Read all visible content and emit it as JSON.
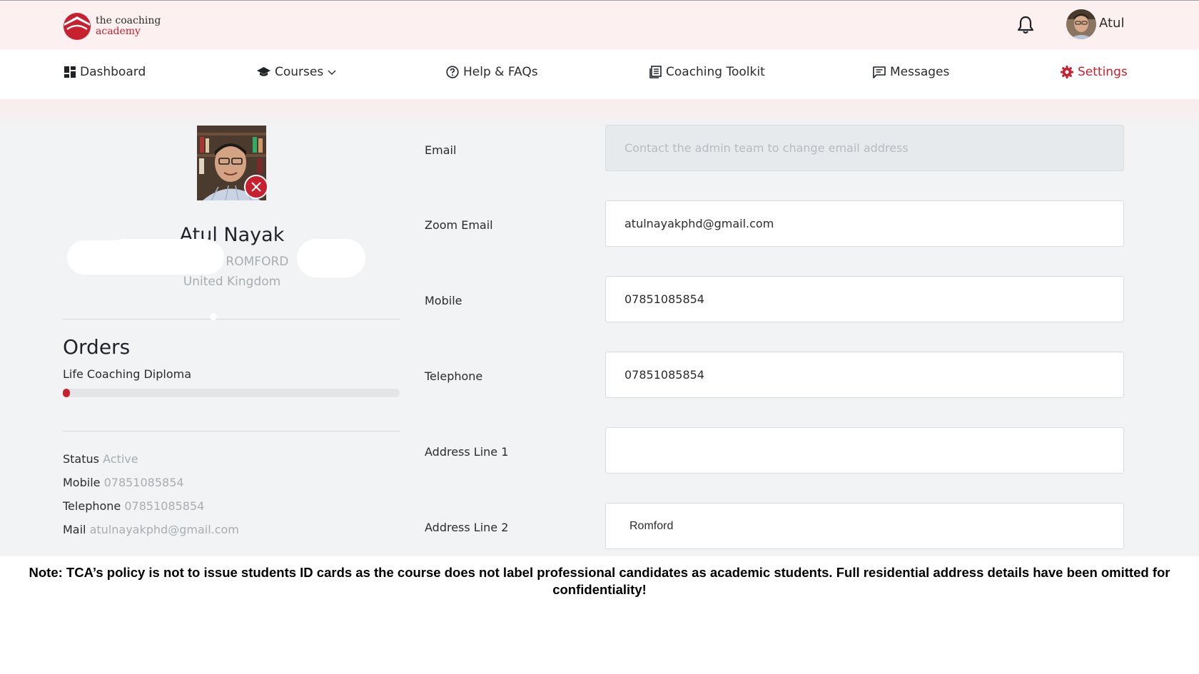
{
  "header": {
    "logo_line1": "the coaching",
    "logo_line2": "academy",
    "user_name": "Atul"
  },
  "nav": [
    {
      "label": "Dashboard",
      "icon": "dashboard-icon"
    },
    {
      "label": "Courses",
      "icon": "graduation-cap-icon"
    },
    {
      "label": "Help & FAQs",
      "icon": "help-circle-icon"
    },
    {
      "label": "Coaching Toolkit",
      "icon": "book-icon"
    },
    {
      "label": "Messages",
      "icon": "message-icon"
    },
    {
      "label": "Settings",
      "icon": "gear-icon",
      "active": true
    }
  ],
  "profile": {
    "name": "Atul Nayak",
    "city": ", ROMFORD",
    "country": "United Kingdom"
  },
  "orders": {
    "title": "Orders",
    "items": [
      {
        "name": "Life Coaching Diploma",
        "progress": 0.01
      }
    ]
  },
  "info": {
    "status_label": "Status",
    "status_value": "Active",
    "mobile_label": "Mobile",
    "mobile_value": "07851085854",
    "telephone_label": "Telephone",
    "telephone_value": "07851085854",
    "mail_label": "Mail",
    "mail_value": "atulnayakphd@gmail.com"
  },
  "form": {
    "email_label": "Email",
    "email_placeholder": "Contact the admin team to change email address",
    "zoom_email_label": "Zoom Email",
    "zoom_email_value": "atulnayakphd@gmail.com",
    "mobile_label": "Mobile",
    "mobile_value": "07851085854",
    "telephone_label": "Telephone",
    "telephone_value": "07851085854",
    "address1_label": "Address Line 1",
    "address1_value": "",
    "address2_label": "Address Line 2",
    "address2_value": "Romford"
  },
  "note": "Note: TCA’s policy is not to issue students ID cards as the course does not label professional candidates as academic students. Full residential address details have been omitted for confidentiality!",
  "colors": {
    "brand_red": "#c8202f",
    "page_bg": "#f1f3f4",
    "header_bg": "#fdf0f0"
  }
}
